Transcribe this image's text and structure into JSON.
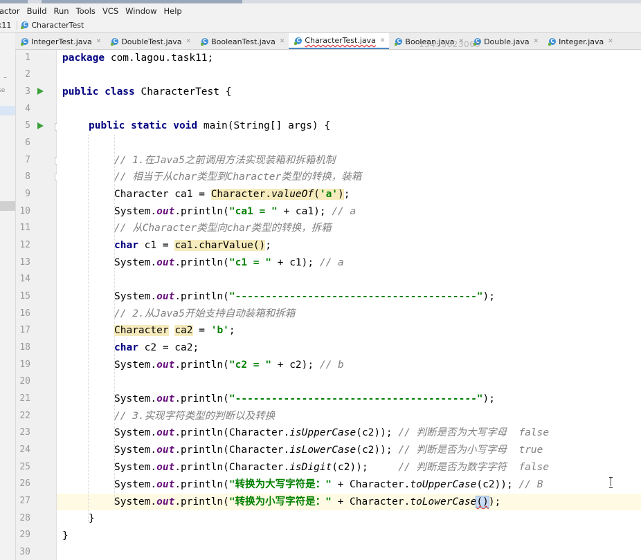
{
  "menu": [
    "actor",
    "Build",
    "Run",
    "Tools",
    "VCS",
    "Window",
    "Help"
  ],
  "breadcrumb": {
    "prev": "k11",
    "file": "CharacterTest"
  },
  "tabs": [
    {
      "label": "IntegerTest.java",
      "active": false
    },
    {
      "label": "DoubleTest.java",
      "active": false
    },
    {
      "label": "BooleanTest.java",
      "active": false
    },
    {
      "label": "CharacterTest.java",
      "active": true
    },
    {
      "label": "Boolean.java",
      "active": false
    },
    {
      "label": "Double.java",
      "active": false
    },
    {
      "label": "Integer.java",
      "active": false
    }
  ],
  "watermark": "13433623069",
  "left_panel": {
    "se_label": "se",
    "dash": "–"
  },
  "line_numbers": [
    "1",
    "2",
    "3",
    "4",
    "5",
    "6",
    "7",
    "8",
    "9",
    "10",
    "11",
    "12",
    "13",
    "14",
    "15",
    "16",
    "17",
    "18",
    "19",
    "20",
    "21",
    "22",
    "23",
    "24",
    "25",
    "26",
    "27",
    "28",
    "29",
    "30"
  ],
  "code": {
    "l1": [
      "package",
      " com.lagou.task11;"
    ],
    "l3": [
      "public class",
      " CharacterTest {"
    ],
    "l5": [
      "public static void",
      " main(String[] args) {"
    ],
    "l7": "// 1.在Java5之前调用方法实现装箱和拆箱机制",
    "l8": "// 相当于从char类型到Character类型的转换，装箱",
    "l9": [
      "Character ca1 = ",
      "Character.",
      "valueOf",
      "(",
      "'a'",
      ")",
      ";"
    ],
    "l10": [
      "System.",
      "out",
      ".println(",
      "\"ca1 = \"",
      " + ca1); ",
      "// a"
    ],
    "l11": "// 从Character类型向char类型的转换，拆箱",
    "l12": [
      "char",
      " c1 = ",
      "ca1.charValue()",
      ";"
    ],
    "l13": [
      "System.",
      "out",
      ".println(",
      "\"c1 = \"",
      " + c1); ",
      "// a"
    ],
    "l15": [
      "System.",
      "out",
      ".println(",
      "\"----------------------------------------\"",
      ");"
    ],
    "l16": "// 2.从Java5开始支持自动装箱和拆箱",
    "l17": [
      "Character",
      " ",
      "ca2",
      " = ",
      "'b'",
      ";"
    ],
    "l18": [
      "char",
      " c2 = ca2;"
    ],
    "l19": [
      "System.",
      "out",
      ".println(",
      "\"c2 = \"",
      " + c2); ",
      "// b"
    ],
    "l21": [
      "System.",
      "out",
      ".println(",
      "\"----------------------------------------\"",
      ");"
    ],
    "l22": "// 3.实现字符类型的判断以及转换",
    "l23": [
      "System.",
      "out",
      ".println(Character.",
      "isUpperCase",
      "(c2)); ",
      "// 判断是否为大写字母  false"
    ],
    "l24": [
      "System.",
      "out",
      ".println(Character.",
      "isLowerCase",
      "(c2)); ",
      "// 判断是否为小写字母  true"
    ],
    "l25": [
      "System.",
      "out",
      ".println(Character.",
      "isDigit",
      "(c2));     ",
      "// 判断是否为数字字符  false"
    ],
    "l26": [
      "System.",
      "out",
      ".println(",
      "\"转换为大写字符是：\"",
      " + Character.",
      "toUpperCase",
      "(c2)); ",
      "// B"
    ],
    "l27": [
      "System.",
      "out",
      ".println(",
      "\"转换为小写字符是：\"",
      " + Character.",
      "toLowerCase",
      "(",
      ")",
      ");"
    ],
    "l28": "}",
    "l29": "}"
  },
  "colors": {
    "keyword": "#000080",
    "string": "#008000",
    "comment": "#808080",
    "field": "#660e7a",
    "highlight": "#f6ebbc",
    "caret_line": "#fffae3",
    "run_icon": "#3aa13a"
  }
}
